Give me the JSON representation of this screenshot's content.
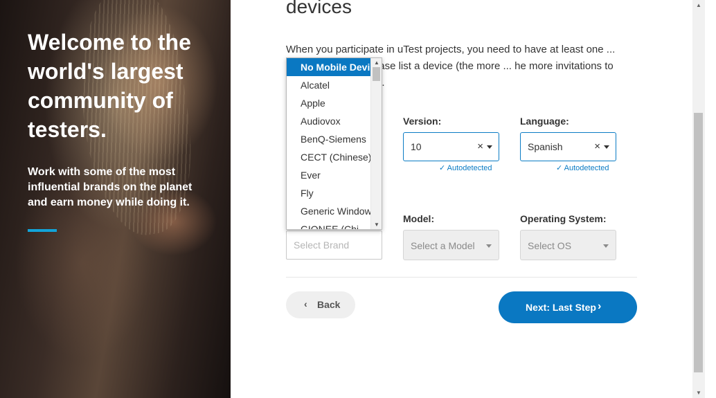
{
  "hero": {
    "title": "Welcome to the world's largest community of testers.",
    "subtitle": "Work with some of the most influential brands on the planet and earn money while doing it.",
    "accent_color": "#12a4d9"
  },
  "section": {
    "heading": "devices",
    "intro": "When you participate in uTest projects, you need to have at least one ... form the test on. Please list a device (the more ... he more invitations to projects you receive)."
  },
  "computer": {
    "version_label": "Version:",
    "version_value": "10",
    "version_autodetected": "✓ Autodetected",
    "language_label": "Language:",
    "language_value": "Spanish",
    "language_autodetected": "✓ Autodetected",
    "clear_icon": "×"
  },
  "mobile": {
    "model_label": "Model:",
    "os_label": "Operating System:",
    "brand_placeholder": "Select Brand",
    "model_placeholder": "Select a Model",
    "os_placeholder": "Select OS"
  },
  "brand_dropdown": {
    "options": [
      "No Mobile Devices",
      "Alcatel",
      "Apple",
      "Audiovox",
      "BenQ-Siemens",
      "CECT (Chinese)",
      "Ever",
      "Fly",
      "Generic Windows",
      "GIONEE (Chi"
    ],
    "selected_index": 0
  },
  "nav": {
    "back_label": "Back",
    "next_label": "Next: Last Step",
    "chevron_left": "‹",
    "chevron_right": "›"
  },
  "colors": {
    "primary": "#0a78c2",
    "back_button_bg": "#efefef"
  }
}
